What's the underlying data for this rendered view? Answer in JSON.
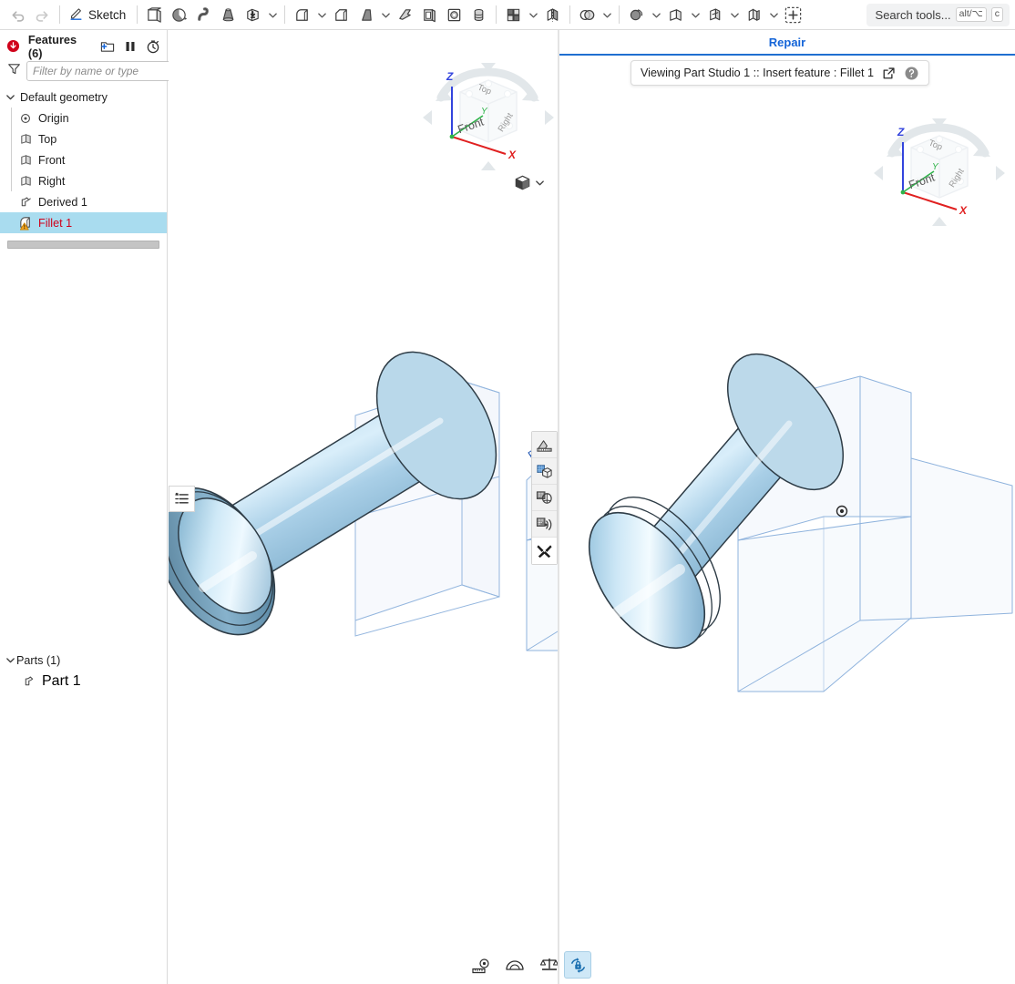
{
  "toolbar": {
    "undo_label": "Undo",
    "redo_label": "Redo",
    "sketch_label": "Sketch",
    "tools": [
      {
        "name": "extrude-tool",
        "label": "Extrude",
        "caret": false
      },
      {
        "name": "revolve-tool",
        "label": "Revolve",
        "caret": false
      },
      {
        "name": "sweep-tool",
        "label": "Sweep",
        "caret": false
      },
      {
        "name": "loft-tool",
        "label": "Loft",
        "caret": false
      },
      {
        "name": "boss-tool",
        "label": "Boss",
        "caret": true
      },
      {
        "name": "fillet-tool",
        "label": "Fillet",
        "caret": true
      },
      {
        "name": "chamfer-tool",
        "label": "Chamfer",
        "caret": false
      },
      {
        "name": "draft-tool",
        "label": "Draft",
        "caret": true
      },
      {
        "name": "rib-tool",
        "label": "Rib",
        "caret": false
      },
      {
        "name": "shell-tool",
        "label": "Shell",
        "caret": false
      },
      {
        "name": "hole-tool",
        "label": "Hole",
        "caret": false
      },
      {
        "name": "thread-tool",
        "label": "Thread",
        "caret": false
      },
      {
        "name": "pattern-tool",
        "label": "Pattern",
        "caret": true
      },
      {
        "name": "mirror-tool",
        "label": "Mirror",
        "caret": false
      },
      {
        "name": "boolean-tool",
        "label": "Boolean",
        "caret": true
      },
      {
        "name": "transform-tool",
        "label": "Transform",
        "caret": true
      },
      {
        "name": "plane-tool",
        "label": "Plane",
        "caret": true
      },
      {
        "name": "split-tool",
        "label": "Split",
        "caret": true
      },
      {
        "name": "sheetmetal-tool",
        "label": "Sheet metal",
        "caret": true
      },
      {
        "name": "insert-feature-tool",
        "label": "Insert feature",
        "caret": false
      }
    ],
    "search_placeholder": "Search tools...",
    "search_kbd_1": "alt/⌥",
    "search_kbd_2": "c"
  },
  "sidebar": {
    "features_title": "Features (6)",
    "filter_placeholder": "Filter by name or type",
    "default_geometry_label": "Default geometry",
    "tree": [
      {
        "label": "Origin",
        "icon": "origin-icon",
        "child": true,
        "selected": false,
        "warning": false
      },
      {
        "label": "Top",
        "icon": "plane-icon",
        "child": true,
        "selected": false,
        "warning": false
      },
      {
        "label": "Front",
        "icon": "plane-icon",
        "child": true,
        "selected": false,
        "warning": false
      },
      {
        "label": "Right",
        "icon": "plane-icon",
        "child": true,
        "selected": false,
        "warning": false
      },
      {
        "label": "Derived 1",
        "icon": "derived-icon",
        "child": false,
        "selected": false,
        "warning": false
      },
      {
        "label": "Fillet 1",
        "icon": "fillet-icon",
        "child": false,
        "selected": true,
        "warning": true
      }
    ],
    "parts_title": "Parts (1)",
    "parts": [
      {
        "label": "Part 1",
        "icon": "part-icon"
      }
    ]
  },
  "viewport_left": {
    "plane_label": "Right",
    "viewcube": {
      "face_top": "Top",
      "face_front": "Front",
      "face_right": "Right",
      "axis_x": "X",
      "axis_y": "Y",
      "axis_z": "Z",
      "axis_x_color": "#e02020",
      "axis_y_color": "#2fb34a",
      "axis_z_color": "#3344dd"
    },
    "side_tools": [
      {
        "name": "section-view-tool",
        "label": "Section view"
      },
      {
        "name": "display-state-tool",
        "label": "Display state"
      },
      {
        "name": "render-tool",
        "label": "Render"
      },
      {
        "name": "appearance-tool",
        "label": "Appearance"
      },
      {
        "name": "utilities-tool",
        "label": "Utilities"
      }
    ],
    "list_flyout_label": "Feature list"
  },
  "viewport_right": {
    "tab_label": "Repair",
    "banner_text": "Viewing Part Studio 1 :: Insert feature : Fillet 1",
    "banner_open_label": "Open in new tab",
    "banner_help_label": "Help",
    "viewcube": {
      "face_top": "Top",
      "face_front": "Front",
      "face_right": "Right",
      "axis_x": "X",
      "axis_y": "Y",
      "axis_z": "Z"
    }
  },
  "bottom_tools": [
    {
      "name": "measure-tool",
      "label": "Measure"
    },
    {
      "name": "angle-tool",
      "label": "Angle"
    },
    {
      "name": "mass-properties-tool",
      "label": "Mass properties"
    }
  ],
  "rotate_lock": {
    "label": "Lock rotation",
    "active": true
  },
  "colors": {
    "accent_blue": "#1565d8",
    "selection_blue": "#a9dcef",
    "error_red": "#d0021b",
    "warning_yellow": "#f5a623",
    "model_blue": "#8fc3e0",
    "plane_blue": "#6e9ddb"
  }
}
